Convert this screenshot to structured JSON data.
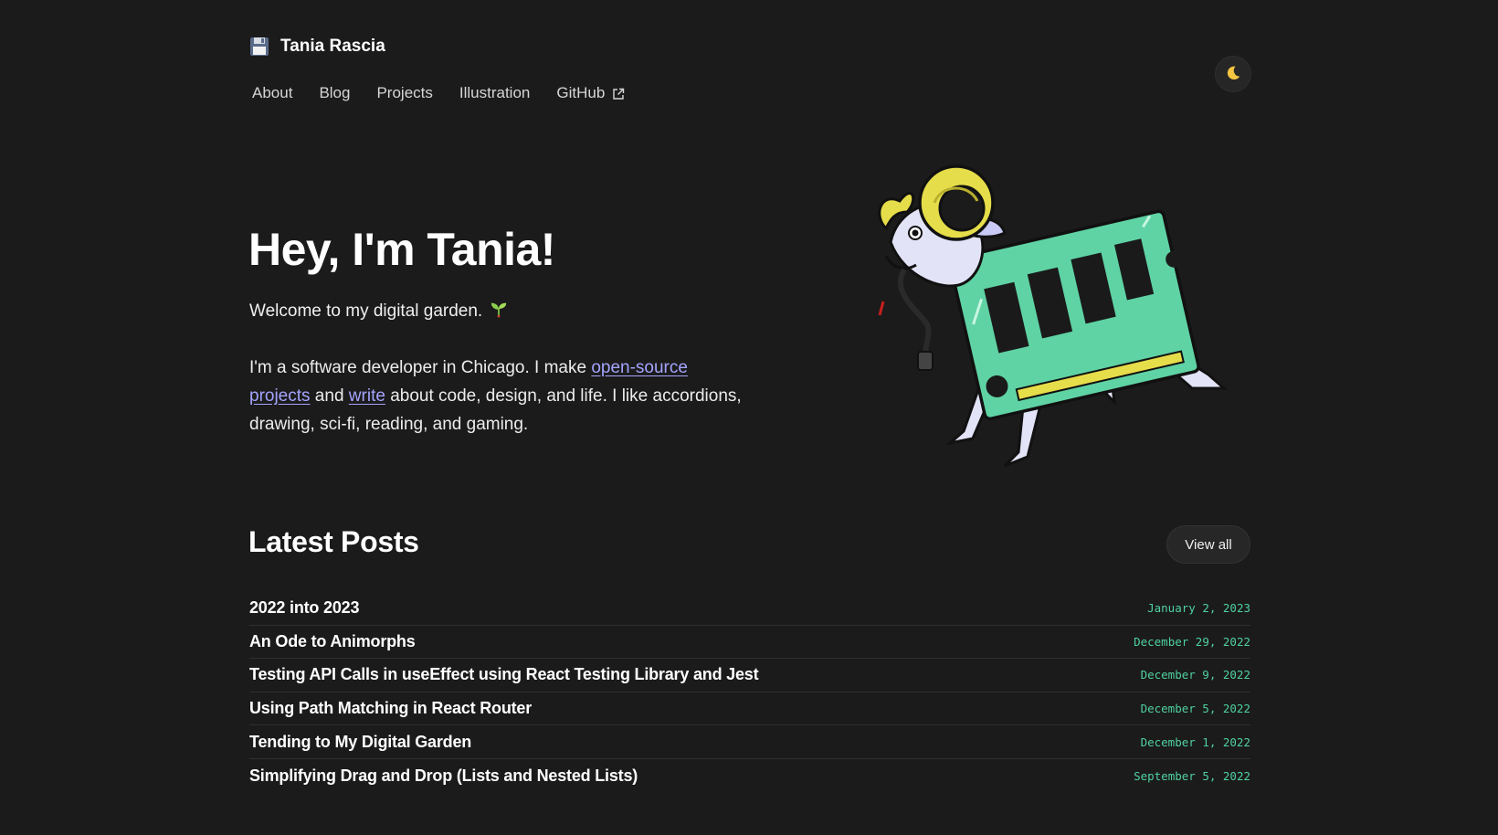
{
  "header": {
    "brand_icon": "floppy-disk-icon",
    "brand_name": "Tania Rascia",
    "nav": [
      {
        "label": "About"
      },
      {
        "label": "Blog"
      },
      {
        "label": "Projects"
      },
      {
        "label": "Illustration"
      },
      {
        "label": "GitHub",
        "external_icon": "external-link-icon"
      }
    ],
    "theme_toggle_icon": "moon-icon"
  },
  "hero": {
    "title": "Hey, I'm Tania!",
    "welcome": "Welcome to my digital garden.",
    "welcome_icon": "seedling-icon",
    "intro_before": "I'm a software developer in Chicago. I make ",
    "intro_link1": "open-source projects",
    "intro_middle": " and ",
    "intro_link2": "write",
    "intro_after": " about code, design, and life. I like accordions, drawing, sci-fi, reading, and gaming.",
    "illustration": "ram-carrying-memory-stick-illustration"
  },
  "latest_posts": {
    "title": "Latest Posts",
    "view_all_label": "View all",
    "items": [
      {
        "title": "2022 into 2023",
        "date": "January 2, 2023"
      },
      {
        "title": "An Ode to Animorphs",
        "date": "December 29, 2022"
      },
      {
        "title": "Testing API Calls in useEffect using React Testing Library and Jest",
        "date": "December 9, 2022"
      },
      {
        "title": "Using Path Matching in React Router",
        "date": "December 5, 2022"
      },
      {
        "title": "Tending to My Digital Garden",
        "date": "December 1, 2022"
      },
      {
        "title": "Simplifying Drag and Drop (Lists and Nested Lists)",
        "date": "September 5, 2022"
      }
    ]
  },
  "colors": {
    "background": "#1b1b1b",
    "link": "#a4a4ff",
    "date": "#4fd1a0",
    "ram_card": "#5fd3a4",
    "horn": "#e6dd4a"
  }
}
